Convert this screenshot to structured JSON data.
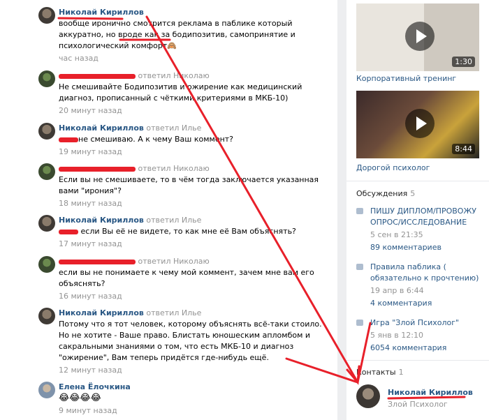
{
  "comments": [
    {
      "author": "Николай Кириллов",
      "reply": "",
      "text": "вообще иронично смотрится реклама в паблике который аккуратно, но вроде как за бодипозитив, самопринятие и психологический комфорт🙈",
      "time": "час назад"
    },
    {
      "author": "",
      "reply": "ответил Николаю",
      "text": "Не смешивайте Бодипозитив и ожирение как медицинский диагноз, прописанный с чёткими критериями в МКБ-10)",
      "time": "20 минут назад"
    },
    {
      "author": "Николай Кириллов",
      "reply": "ответил Илье",
      "text": "не смешиваю. А к чему Ваш коммент?",
      "time": "19 минут назад"
    },
    {
      "author": "",
      "reply": "ответил Николаю",
      "text": "Если вы не смешиваете, то в чём тогда заключается указанная вами \"ирония\"?",
      "time": "18 минут назад"
    },
    {
      "author": "Николай Кириллов",
      "reply": "ответил Илье",
      "text": "если Вы её не видете, то как мне её Вам объяснять?",
      "time": "17 минут назад"
    },
    {
      "author": "",
      "reply": "ответил Николаю",
      "text": "если вы не понимаете к чему мой коммент, зачем мне вам его объяснять?",
      "time": "16 минут назад"
    },
    {
      "author": "Николай Кириллов",
      "reply": "ответил Илье",
      "text": "Потому что я тот человек, которому объяснять всё-таки стоило. Но не хотите - Ваше право. Блистать юношеским апломбом и сакральными знаниями о том, что есть МКБ-10 и диагноз \"ожирение\", Вам теперь придётся где-нибудь ещё.",
      "time": "12 минут назад"
    },
    {
      "author": "Елена Ёлочкина",
      "reply": "",
      "text": "😂😂😂😂",
      "time": "9 минут назад"
    }
  ],
  "videos": [
    {
      "title": "Корпоративный тренинг",
      "duration": "1:30"
    },
    {
      "title": "Дорогой психолог",
      "duration": "8:44"
    }
  ],
  "discussions": {
    "label": "Обсуждения",
    "count": "5",
    "items": [
      {
        "title": "ПИШУ ДИПЛОМ/ПРОВОЖУ ОПРОС/ИССЛЕДОВАНИЕ",
        "date": "5 сен в 21:35",
        "comments": "89 комментариев"
      },
      {
        "title": "Правила паблика ( обязательно к прочтению)",
        "date": "19 апр в 6:44",
        "comments": "4 комментария"
      },
      {
        "title": "Игра \"Злой Психолог\"",
        "date": "5 янв в 12:10",
        "comments": "6054 комментария"
      }
    ]
  },
  "contacts": {
    "label": "Контакты",
    "count": "1",
    "name": "Николай Кириллов",
    "role": "Злой Психолог"
  },
  "colors": {
    "link": "#2a5885",
    "muted": "#939393",
    "annotation": "#e8202a",
    "background": "#edeef0"
  }
}
